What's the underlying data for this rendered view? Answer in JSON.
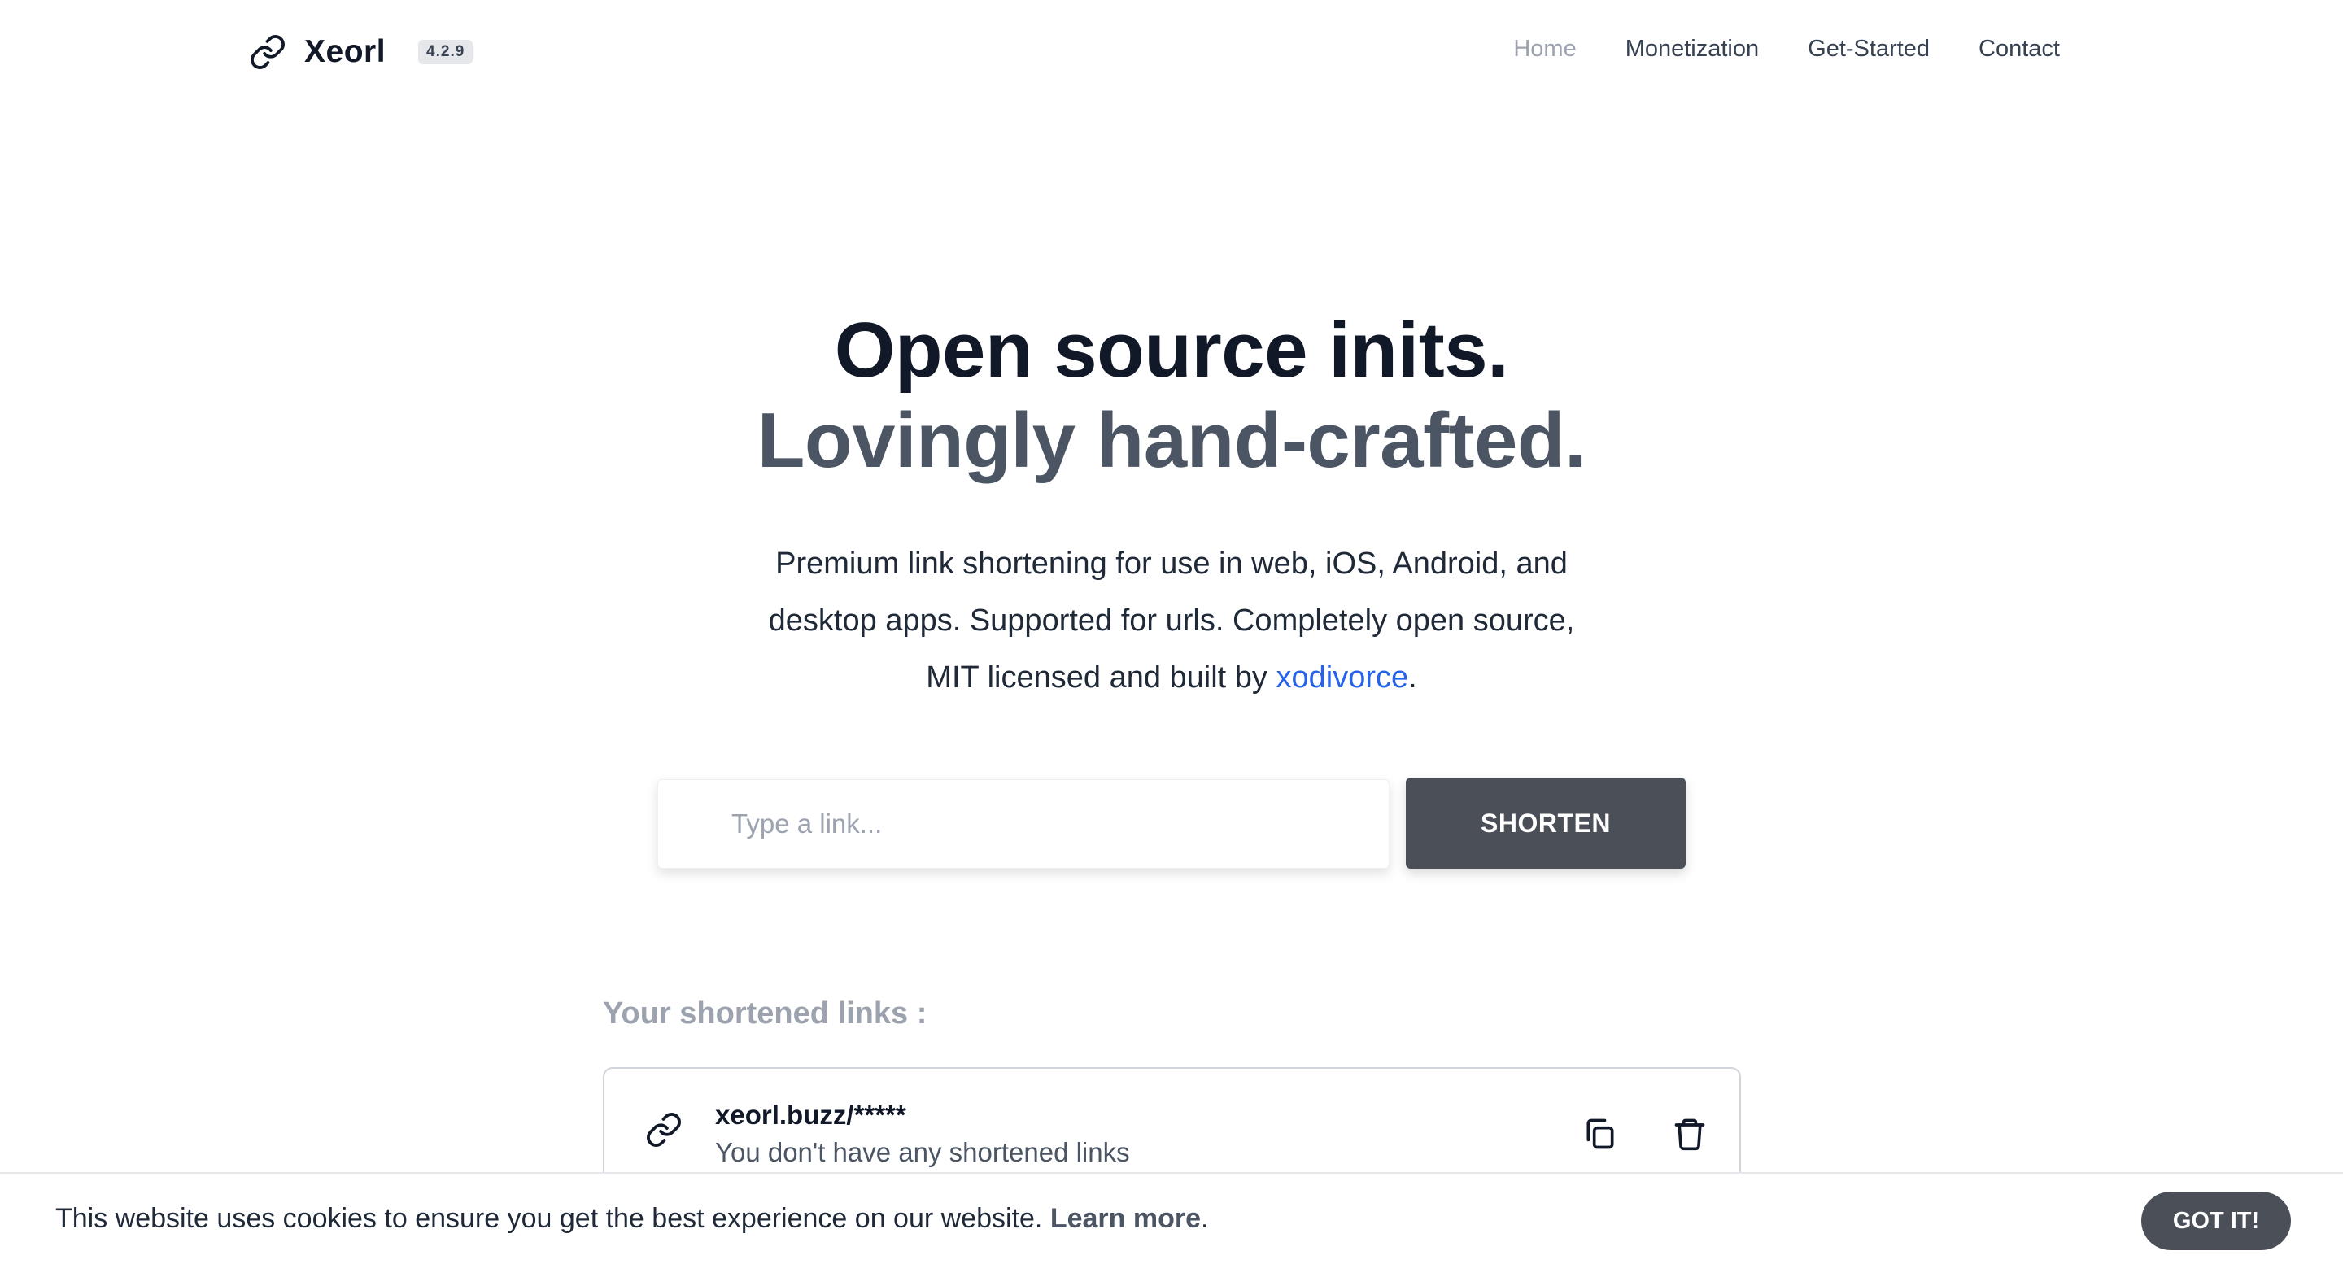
{
  "header": {
    "brand_name": "Xeorl",
    "brand_icon": "link-icon",
    "version": "4.2.9",
    "nav": [
      {
        "label": "Home",
        "active": true
      },
      {
        "label": "Monetization",
        "active": false
      },
      {
        "label": "Get-Started",
        "active": false
      },
      {
        "label": "Contact",
        "active": false
      }
    ]
  },
  "hero": {
    "title_line1": "Open source inits.",
    "title_line2": "Lovingly hand-crafted.",
    "subtitle_line1": "Premium link shortening for use in web, iOS, Android, and",
    "subtitle_line2": "desktop apps. Supported for urls. Completely open source,",
    "subtitle_line3_prefix": "MIT licensed and built by ",
    "subtitle_link": "xodivorce",
    "subtitle_line3_suffix": "."
  },
  "shortener": {
    "input_placeholder": "Type a link...",
    "input_value": "",
    "button_label": "SHORTEN"
  },
  "links": {
    "heading": "Your shortened links :",
    "items": [
      {
        "url": "xeorl.buzz/*****",
        "message": "You don't have any shortened links",
        "icon": "link-icon",
        "actions": [
          "copy-icon",
          "trash-icon"
        ]
      }
    ]
  },
  "cookie": {
    "text": "This website uses cookies to ensure you get the best experience on our website. ",
    "link_label": "Learn more",
    "suffix": ".",
    "button_label": "GOT IT!"
  },
  "colors": {
    "primary_dark": "#4b5058",
    "accent_link": "#2563eb",
    "muted": "#9ca3af",
    "heading_dark": "#111827",
    "heading_gray": "#4b5563"
  }
}
